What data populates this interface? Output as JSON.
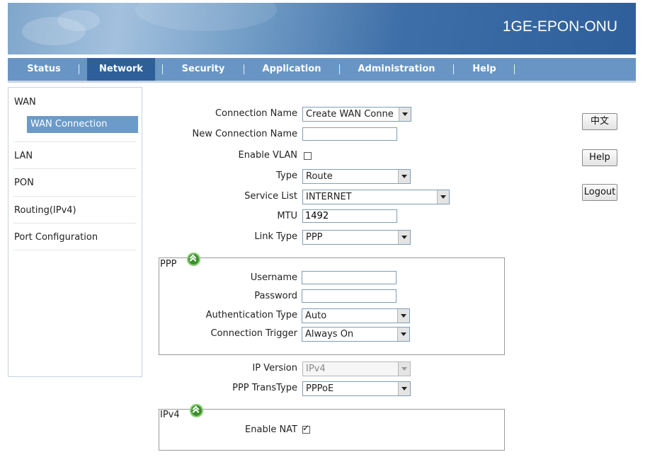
{
  "banner": {
    "title": "1GE-EPON-ONU"
  },
  "nav": {
    "tabs": [
      {
        "label": "Status"
      },
      {
        "label": "Network"
      },
      {
        "label": "Security"
      },
      {
        "label": "Application"
      },
      {
        "label": "Administration"
      },
      {
        "label": "Help"
      }
    ],
    "active": "Network"
  },
  "sidebar": {
    "wan": "WAN",
    "wan_connection": "WAN Connection",
    "lan": "LAN",
    "pon": "PON",
    "routing": "Routing(IPv4)",
    "port_config": "Port Configuration"
  },
  "form": {
    "connection_name": {
      "label": "Connection Name",
      "value": "Create WAN Conne"
    },
    "new_connection_name": {
      "label": "New Connection Name",
      "value": ""
    },
    "enable_vlan": {
      "label": "Enable VLAN",
      "checked": false
    },
    "type": {
      "label": "Type",
      "value": "Route"
    },
    "service_list": {
      "label": "Service List",
      "value": "INTERNET"
    },
    "mtu": {
      "label": "MTU",
      "value": "1492"
    },
    "link_type": {
      "label": "Link Type",
      "value": "PPP"
    },
    "ppp": {
      "title": "PPP",
      "username": {
        "label": "Username",
        "value": ""
      },
      "password": {
        "label": "Password",
        "value": ""
      },
      "auth_type": {
        "label": "Authentication Type",
        "value": "Auto"
      },
      "conn_trigger": {
        "label": "Connection Trigger",
        "value": "Always On"
      }
    },
    "ip_version": {
      "label": "IP Version",
      "value": "IPv4"
    },
    "ppp_transtype": {
      "label": "PPP TransType",
      "value": "PPPoE"
    },
    "ipv4": {
      "title": "IPv4",
      "enable_nat": {
        "label": "Enable NAT",
        "checked": true
      }
    }
  },
  "buttons": {
    "lang": "中文",
    "help": "Help",
    "logout": "Logout"
  },
  "colors": {
    "nav_bg": "#6895c4",
    "nav_active": "#2e5f99",
    "side_active": "#6c9ac9",
    "collapse_icon": "#3b8f2c"
  }
}
